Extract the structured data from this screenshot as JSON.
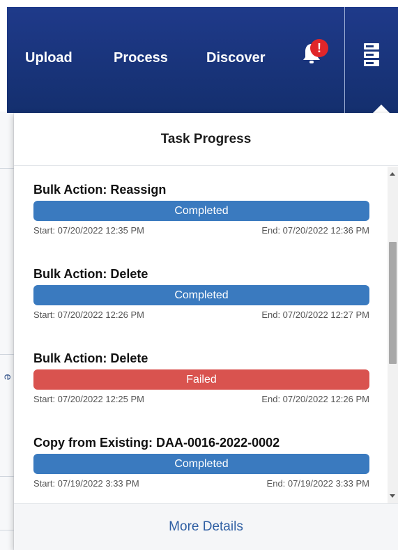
{
  "nav": {
    "links": [
      "Upload",
      "Process",
      "Discover"
    ],
    "notification_badge": "!",
    "menu_icon": "server-list-icon",
    "background_color": "#1a3578"
  },
  "background": {
    "partial_char": "e"
  },
  "task_panel": {
    "title": "Task Progress",
    "tasks": [
      {
        "title": "Bulk Action: Reassign",
        "status": "Completed",
        "start": "Start: 07/20/2022 12:35 PM",
        "end": "End: 07/20/2022 12:36 PM",
        "status_color": "#3a7abf"
      },
      {
        "title": "Bulk Action: Delete",
        "status": "Completed",
        "start": "Start: 07/20/2022 12:26 PM",
        "end": "End: 07/20/2022 12:27 PM",
        "status_color": "#3a7abf"
      },
      {
        "title": "Bulk Action: Delete",
        "status": "Failed",
        "start": "Start: 07/20/2022 12:25 PM",
        "end": "End: 07/20/2022 12:26 PM",
        "status_color": "#d9534f"
      },
      {
        "title": "Copy from Existing: DAA-0016-2022-0002",
        "status": "Completed",
        "start": "Start: 07/19/2022 3:33 PM",
        "end": "End: 07/19/2022 3:33 PM",
        "status_color": "#3a7abf"
      }
    ],
    "footer_link": "More Details"
  }
}
